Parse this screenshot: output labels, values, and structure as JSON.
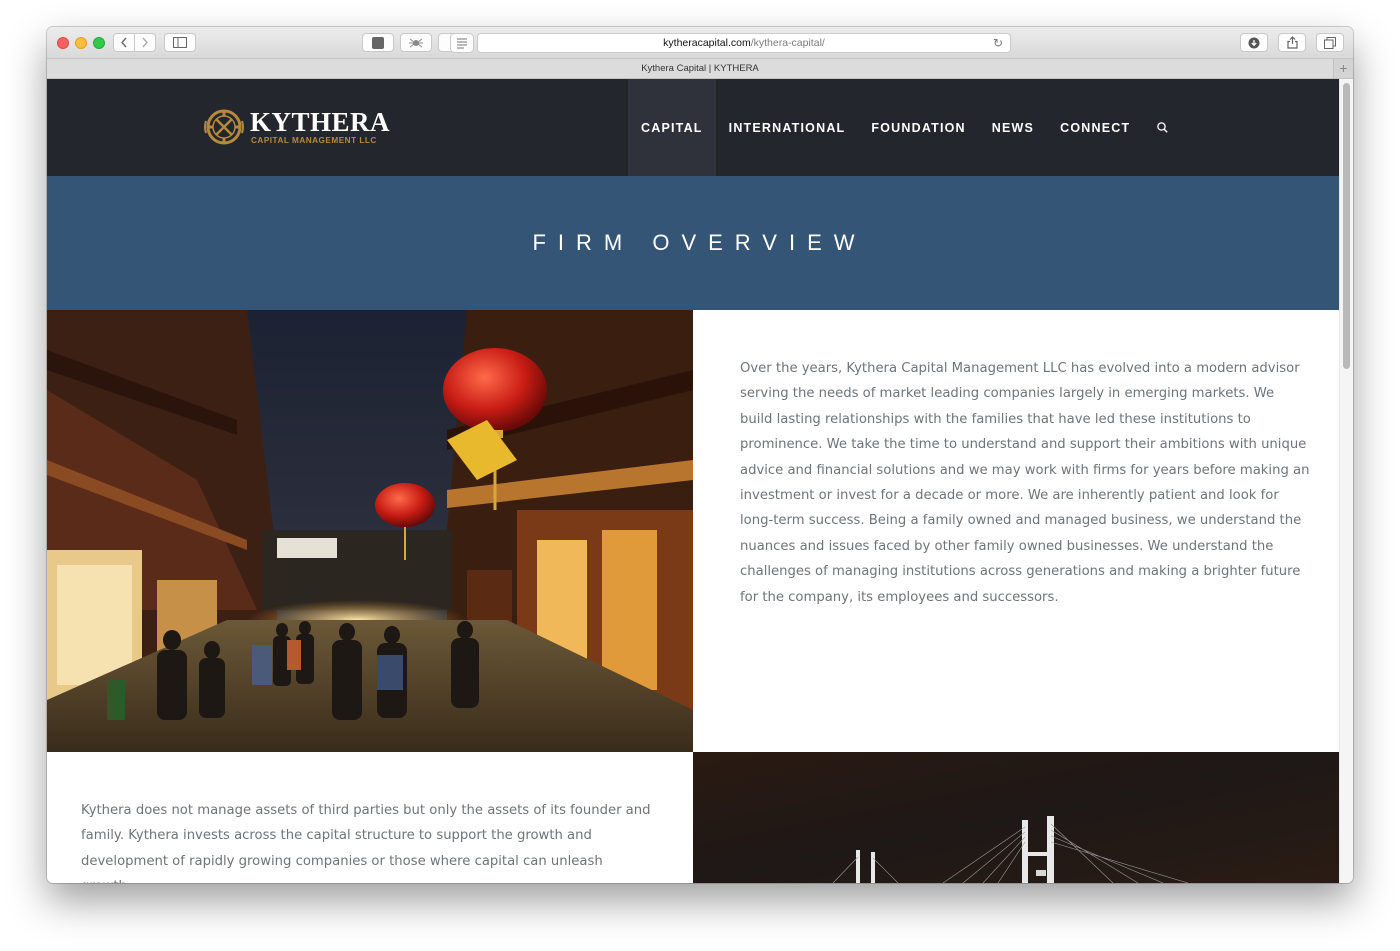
{
  "browser": {
    "url_host": "kytheracapital.com",
    "url_path": "/kythera-capital/",
    "tab_title": "Kythera Capital | KYTHERA",
    "new_tab_label": "+"
  },
  "site": {
    "logo_name": "KYTHERA",
    "logo_sub": "CAPITAL MANAGEMENT LLC",
    "nav": [
      "CAPITAL",
      "INTERNATIONAL",
      "FOUNDATION",
      "NEWS",
      "CONNECT"
    ],
    "hero_title": "FIRM OVERVIEW",
    "paragraph_1": "Over the years, Kythera Capital Management LLC has evolved into a modern advisor serving the needs of market leading companies largely in emerging markets. We build lasting relationships with the families that have led these institutions to prominence. We take the time to understand and support their ambitions with unique advice and financial solutions and we may work with firms for years before making an investment or invest for a decade or more. We are inherently patient and look for long-term success. Being a family owned and managed business, we understand the nuances and issues faced by other family owned businesses. We understand the challenges of managing institutions across generations and making a brighter future for the company, its employees and successors.",
    "paragraph_2": "Kythera does not manage assets of third parties but only the assets of its founder and family. Kythera invests across the capital structure to support the growth and development of rapidly growing companies or those where capital can unleash growth"
  },
  "colors": {
    "header_bg": "#24262d",
    "hero_bg": "#355576",
    "logo_gold": "#b58a3e",
    "body_text": "#6f7478"
  },
  "icons": {
    "search": "search-icon",
    "reload": "reload-icon",
    "back": "chevron-left-icon",
    "forward": "chevron-right-icon"
  }
}
